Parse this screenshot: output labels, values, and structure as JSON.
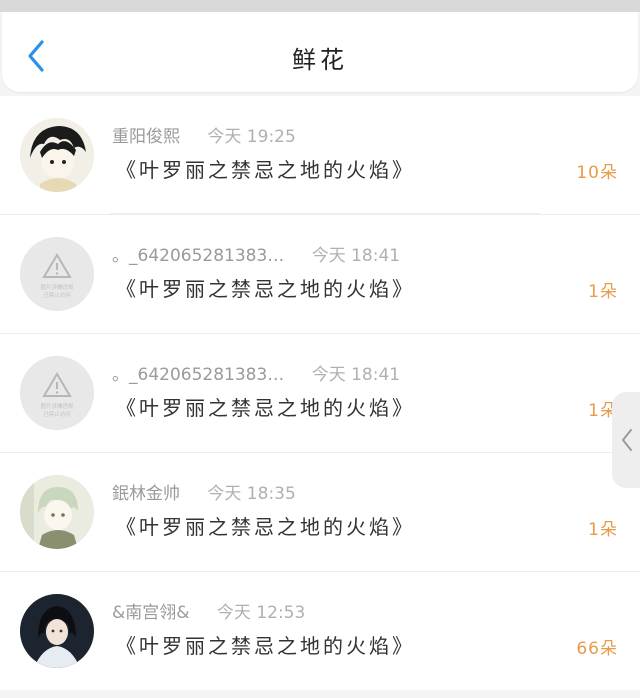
{
  "header": {
    "title": "鲜花",
    "back_icon": "chevron-left-icon",
    "accent_color": "#2a8fe8"
  },
  "list": [
    {
      "name": "重阳俊熙",
      "time": "今天 19:25",
      "book": "《叶罗丽之禁忌之地的火焰》",
      "count": "10朵",
      "avatar": "anime-boy-avatar"
    },
    {
      "name": "。_642065281383…",
      "time": "今天 18:41",
      "book": "《叶罗丽之禁忌之地的火焰》",
      "count": "1朵",
      "avatar": "image-blocked-avatar",
      "avatar_text": [
        "图片涉嫌违规",
        "已禁止访问"
      ]
    },
    {
      "name": "。_642065281383…",
      "time": "今天 18:41",
      "book": "《叶罗丽之禁忌之地的火焰》",
      "count": "1朵",
      "avatar": "image-blocked-avatar",
      "avatar_text": [
        "图片涉嫌违规",
        "已禁止访问"
      ]
    },
    {
      "name": "鈱林金帅",
      "time": "今天 18:35",
      "book": "《叶罗丽之禁忌之地的火焰》",
      "count": "1朵",
      "avatar": "anime-girl-avatar"
    },
    {
      "name": "&南宫翎&",
      "time": "今天 12:53",
      "book": "《叶罗丽之禁忌之地的火焰》",
      "count": "66朵",
      "avatar": "portrait-avatar"
    }
  ],
  "count_color": "#e89b4a",
  "side_tab_icon": "chevron-left-icon"
}
